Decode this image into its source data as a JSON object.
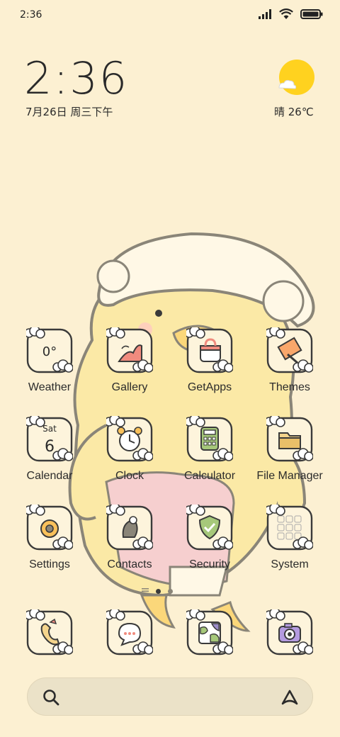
{
  "status_bar": {
    "time": "2:36",
    "icons": [
      "signal-icon",
      "wifi-icon",
      "battery-icon"
    ]
  },
  "clock_widget": {
    "time": "2:36",
    "date": "7月26日 周三下午"
  },
  "weather_widget": {
    "icon": "sunny-cloud-icon",
    "text": "晴 26℃"
  },
  "apps": [
    {
      "label": "Weather",
      "icon": "weather-icon",
      "tile_text": "0°"
    },
    {
      "label": "Gallery",
      "icon": "gallery-icon"
    },
    {
      "label": "GetApps",
      "icon": "getapps-bag-icon"
    },
    {
      "label": "Themes",
      "icon": "themes-brush-icon"
    },
    {
      "label": "Calendar",
      "icon": "calendar-icon",
      "tile_day": "Sat",
      "tile_date": "6"
    },
    {
      "label": "Clock",
      "icon": "alarm-clock-icon"
    },
    {
      "label": "Calculator",
      "icon": "calculator-icon"
    },
    {
      "label": "File Manager",
      "icon": "folder-icon"
    },
    {
      "label": "Settings",
      "icon": "gear-icon"
    },
    {
      "label": "Contacts",
      "icon": "contacts-icon"
    },
    {
      "label": "Security",
      "icon": "shield-icon"
    },
    {
      "label": "System",
      "icon": "system-folder-icon"
    }
  ],
  "dock": [
    {
      "icon": "phone-icon"
    },
    {
      "icon": "messages-icon"
    },
    {
      "icon": "browser-icon"
    },
    {
      "icon": "camera-icon"
    }
  ],
  "page_indicator": {
    "pages": 2,
    "current": 0
  },
  "colors": {
    "background": "#fcf0d2",
    "search_bar": "#ebe2c8",
    "sun": "#ffd21f",
    "outline": "#3a3a3a"
  }
}
